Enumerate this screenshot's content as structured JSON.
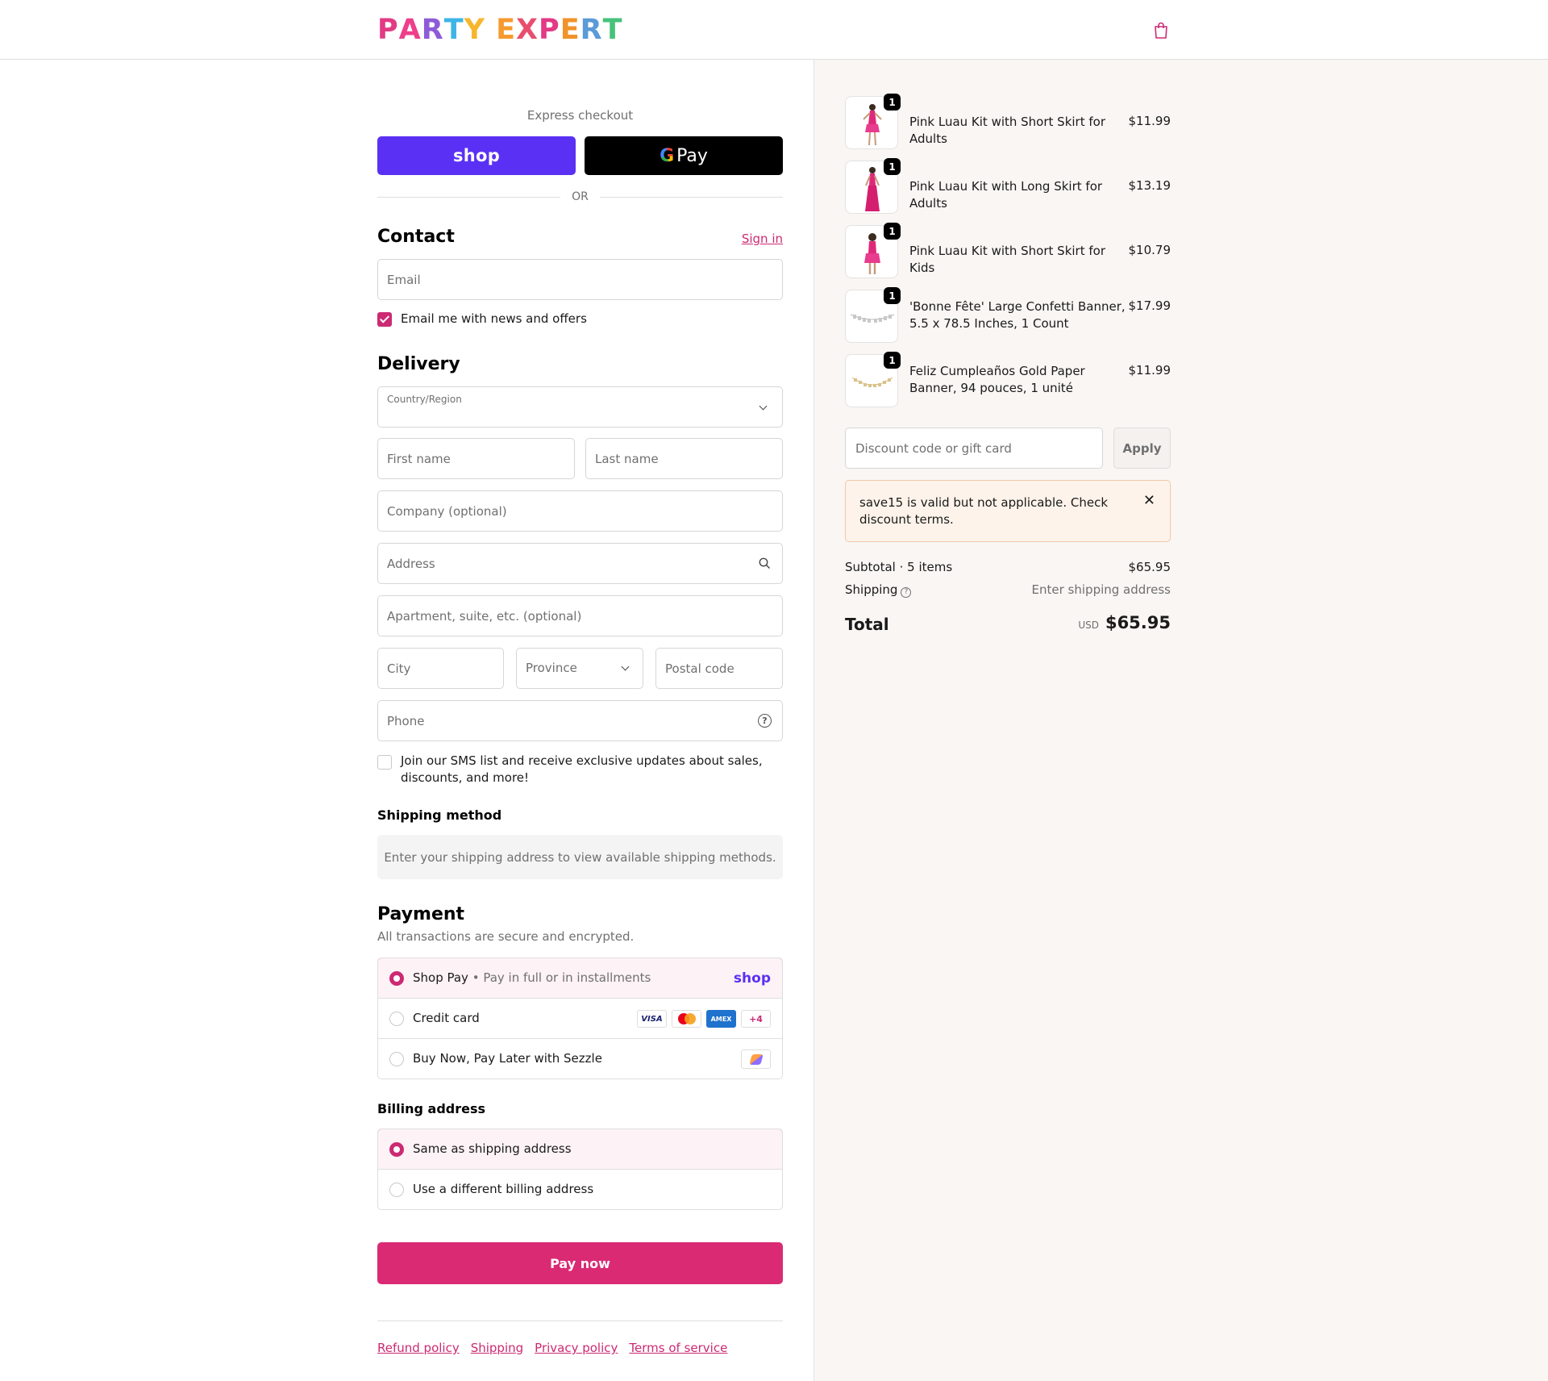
{
  "header": {
    "logo_letters": [
      {
        "ch": "P",
        "color": "#e23a85"
      },
      {
        "ch": "A",
        "color": "#ee3f8b"
      },
      {
        "ch": "R",
        "color": "#8e5bd8"
      },
      {
        "ch": "T",
        "color": "#3fb4e6"
      },
      {
        "ch": "Y",
        "color": "#f6b72d"
      },
      {
        "ch": " ",
        "color": "#000000"
      },
      {
        "ch": "E",
        "color": "#f59a2f"
      },
      {
        "ch": "X",
        "color": "#e94e6f"
      },
      {
        "ch": "P",
        "color": "#e23a85"
      },
      {
        "ch": "E",
        "color": "#f0932b"
      },
      {
        "ch": "R",
        "color": "#5a9bd8"
      },
      {
        "ch": "T",
        "color": "#46c27a"
      }
    ],
    "cart_icon": "shopping-bag-icon"
  },
  "express": {
    "title": "Express checkout",
    "shop_label": "shop",
    "gpay_g": "G",
    "gpay_label": "Pay",
    "or": "OR"
  },
  "contact": {
    "title": "Contact",
    "signin": "Sign in",
    "email_placeholder": "Email",
    "news_label": "Email me with news and offers",
    "news_checked": true
  },
  "delivery": {
    "title": "Delivery",
    "country_label": "Country/Region",
    "first_name": "First name",
    "last_name": "Last name",
    "company": "Company (optional)",
    "address": "Address",
    "apartment": "Apartment, suite, etc. (optional)",
    "city": "City",
    "province": "Province",
    "postal": "Postal code",
    "phone": "Phone",
    "sms_label_1": "Join our SMS list and receive exclusive updates about sales,",
    "sms_label_2": "discounts, and more!",
    "sms_checked": false
  },
  "shipping_method": {
    "title": "Shipping method",
    "message": "Enter your shipping address to view available shipping methods."
  },
  "payment": {
    "title": "Payment",
    "subtitle": "All transactions are secure and encrypted.",
    "options": [
      {
        "label": "Shop Pay",
        "sep": " • ",
        "detail": "Pay in full or in installments",
        "selected": true,
        "brand": "shop"
      },
      {
        "label": "Credit card",
        "selected": false,
        "cards": [
          "VISA",
          "mastercard",
          "AMEX",
          "+4"
        ]
      },
      {
        "label": "Buy Now, Pay Later with Sezzle",
        "selected": false
      }
    ]
  },
  "billing": {
    "title": "Billing address",
    "options": [
      {
        "label": "Same as shipping address",
        "selected": true
      },
      {
        "label": "Use a different billing address",
        "selected": false
      }
    ]
  },
  "pay_button": "Pay now",
  "footer": {
    "links": [
      "Refund policy",
      "Shipping",
      "Privacy policy",
      "Terms of service"
    ]
  },
  "summary": {
    "items": [
      {
        "qty": "1",
        "name": "Pink Luau Kit with Short Skirt for Adults",
        "price": "$11.99"
      },
      {
        "qty": "1",
        "name": "Pink Luau Kit with Long Skirt for Adults",
        "price": "$13.19"
      },
      {
        "qty": "1",
        "name": "Pink Luau Kit with Short Skirt for Kids",
        "price": "$10.79"
      },
      {
        "qty": "1",
        "name": "'Bonne Fête' Large Confetti Banner, 5.5 x 78.5 Inches, 1 Count",
        "price": "$17.99"
      },
      {
        "qty": "1",
        "name": "Feliz Cumpleaños Gold Paper Banner, 94 pouces, 1 unité",
        "price": "$11.99"
      }
    ],
    "discount_placeholder": "Discount code or gift card",
    "apply": "Apply",
    "notice": "save15 is valid but not applicable. Check discount terms.",
    "subtotal_label": "Subtotal · 5 items",
    "subtotal_value": "$65.95",
    "shipping_label": "Shipping",
    "shipping_value": "Enter shipping address",
    "total_label": "Total",
    "currency": "USD",
    "total_value": "$65.95"
  },
  "colors": {
    "accent": "#cc2a73",
    "pay_button": "#da2a74",
    "shop_pay": "#5a31f4"
  }
}
